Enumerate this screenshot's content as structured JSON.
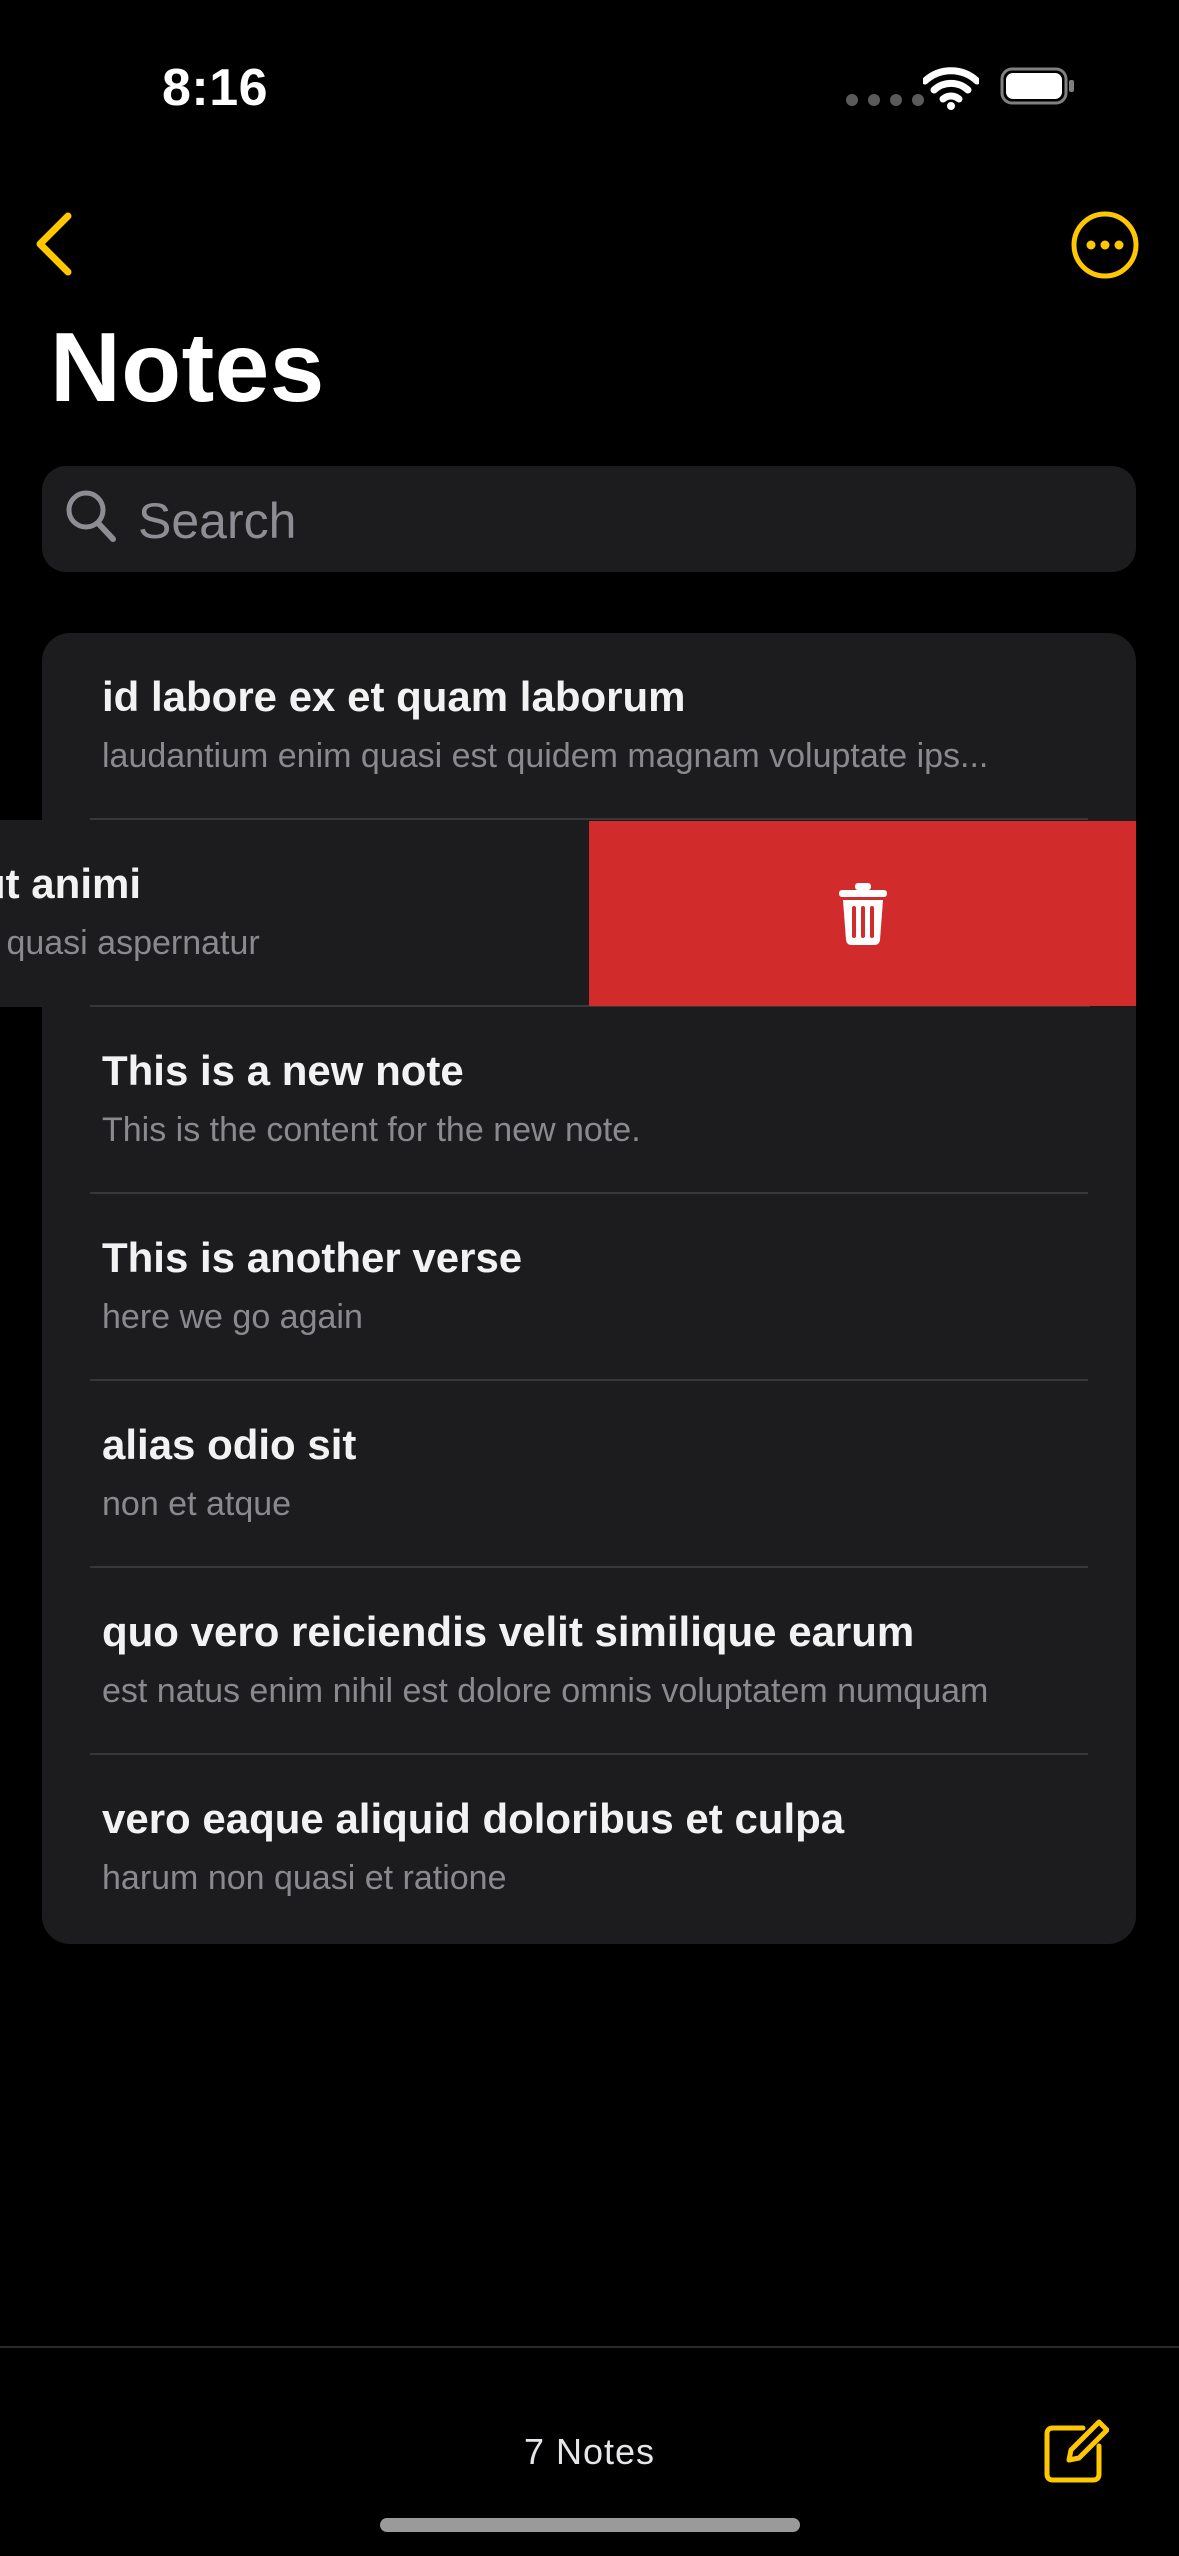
{
  "status_bar": {
    "time": "8:16"
  },
  "header": {
    "title": "Notes"
  },
  "search": {
    "placeholder": "Search"
  },
  "notes": [
    {
      "title": "id labore ex et quam laborum",
      "subtitle": "laudantium enim quasi est quidem magnam voluptate ips..."
    },
    {
      "title": "ut animi",
      "subtitle": "it quasi aspernatur"
    },
    {
      "title": "This is a new note",
      "subtitle": "This is the content for the new note."
    },
    {
      "title": "This is another verse",
      "subtitle": "here we go again"
    },
    {
      "title": "alias odio sit",
      "subtitle": "non et atque"
    },
    {
      "title": "quo vero reiciendis velit similique earum",
      "subtitle": "est natus enim nihil est dolore omnis voluptatem numquam"
    },
    {
      "title": "vero eaque aliquid doloribus et culpa",
      "subtitle": "harum non quasi et ratione"
    }
  ],
  "toolbar": {
    "count_label": "7 Notes"
  },
  "colors": {
    "accent": "#FFC700",
    "delete": "#D12B2B",
    "background": "#000000",
    "cell": "#1C1C1E"
  },
  "icons": [
    "back-chevron-icon",
    "more-icon",
    "search-icon",
    "trash-icon",
    "compose-icon",
    "wifi-icon",
    "battery-icon"
  ]
}
